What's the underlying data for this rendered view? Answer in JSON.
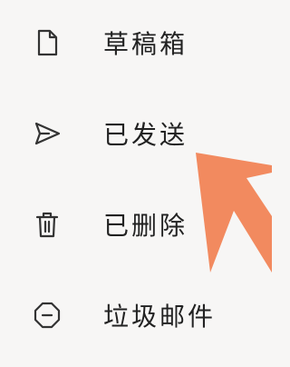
{
  "menu": {
    "items": [
      {
        "label": "草稿箱",
        "icon": "document-icon"
      },
      {
        "label": "已发送",
        "icon": "send-icon"
      },
      {
        "label": "已删除",
        "icon": "trash-icon"
      },
      {
        "label": "垃圾邮件",
        "icon": "minus-circle-icon"
      }
    ]
  },
  "colors": {
    "background": "#f7f6f5",
    "text": "#222222",
    "icon": "#333333",
    "annotation_arrow": "#f28a5f"
  }
}
